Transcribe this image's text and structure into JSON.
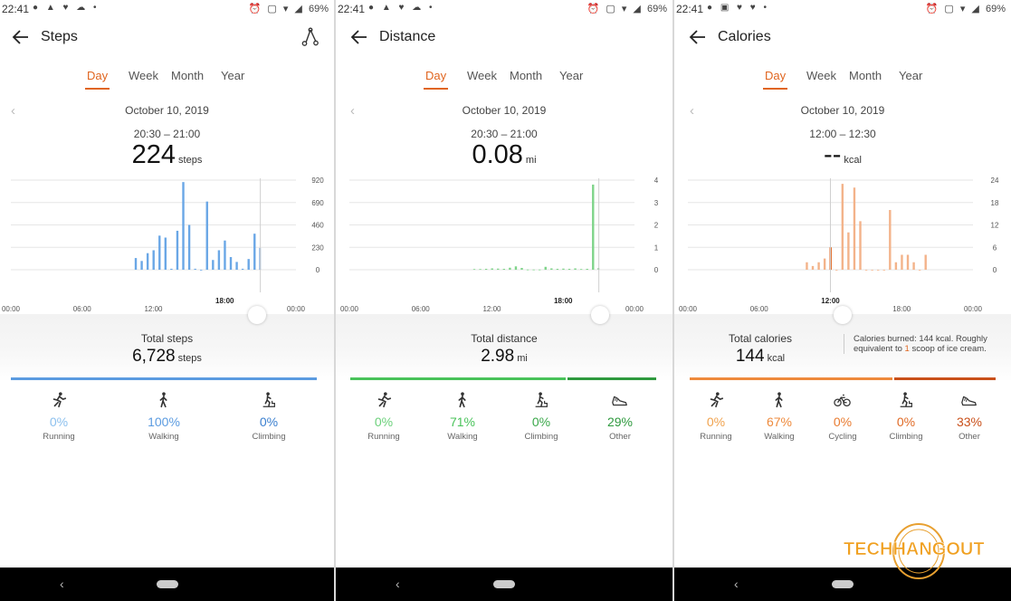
{
  "screens": [
    {
      "status": {
        "time": "22:41",
        "battery": "69%"
      },
      "title": "Steps",
      "tabs": [
        "Day",
        "Week",
        "Month",
        "Year"
      ],
      "active_tab": "Day",
      "date": "October 10, 2019",
      "range": "20:30 – 21:00",
      "value": "224",
      "value_unit": "steps",
      "total_label": "Total steps",
      "total_value": "6,728",
      "total_unit": "steps",
      "accent": "#5b9be0",
      "activities": [
        {
          "icon": "running-icon",
          "pct": "0%",
          "label": "Running",
          "color": "#8cc0ee"
        },
        {
          "icon": "walking-icon",
          "pct": "100%",
          "label": "Walking",
          "color": "#5b9be0"
        },
        {
          "icon": "climbing-icon",
          "pct": "0%",
          "label": "Climbing",
          "color": "#3a7fcf"
        }
      ]
    },
    {
      "status": {
        "time": "22:41",
        "battery": "69%"
      },
      "title": "Distance",
      "tabs": [
        "Day",
        "Week",
        "Month",
        "Year"
      ],
      "active_tab": "Day",
      "date": "October 10, 2019",
      "range": "20:30 – 21:00",
      "value": "0.08",
      "value_unit": "mi",
      "total_label": "Total distance",
      "total_value": "2.98",
      "total_unit": "mi",
      "accent": "#49c35a",
      "activities": [
        {
          "icon": "running-icon",
          "pct": "0%",
          "label": "Running",
          "color": "#6bd07a"
        },
        {
          "icon": "walking-icon",
          "pct": "71%",
          "label": "Walking",
          "color": "#49c35a"
        },
        {
          "icon": "climbing-icon",
          "pct": "0%",
          "label": "Climbing",
          "color": "#3aa84a"
        },
        {
          "icon": "shoe-icon",
          "pct": "29%",
          "label": "Other",
          "color": "#2f9a3f"
        }
      ]
    },
    {
      "status": {
        "time": "22:41",
        "battery": "69%"
      },
      "title": "Calories",
      "tabs": [
        "Day",
        "Week",
        "Month",
        "Year"
      ],
      "active_tab": "Day",
      "date": "October 10, 2019",
      "range": "12:00 – 12:30",
      "value": "--",
      "value_unit": "kcal",
      "total_label": "Total calories",
      "total_value": "144",
      "total_unit": "kcal",
      "burn_note_prefix": "Calories burned: 144 kcal. Roughly equivalent to ",
      "burn_note_highlight": "1",
      "burn_note_suffix": " scoop of ice cream.",
      "accent": "#ee8a3c",
      "activities": [
        {
          "icon": "running-icon",
          "pct": "0%",
          "label": "Running",
          "color": "#f0a24d"
        },
        {
          "icon": "walking-icon",
          "pct": "67%",
          "label": "Walking",
          "color": "#ee8a3c"
        },
        {
          "icon": "cycling-icon",
          "pct": "0%",
          "label": "Cycling",
          "color": "#e97b30"
        },
        {
          "icon": "climbing-icon",
          "pct": "0%",
          "label": "Climbing",
          "color": "#e06a25"
        },
        {
          "icon": "shoe-icon",
          "pct": "33%",
          "label": "Other",
          "color": "#c9501a"
        }
      ]
    }
  ],
  "chart_data": [
    {
      "type": "bar",
      "title": "",
      "x_ticks": [
        "00:00",
        "06:00",
        "12:00",
        "18:00",
        "00:00"
      ],
      "highlight_tick": "18:00",
      "y_ticks": [
        0,
        230,
        460,
        690,
        920
      ],
      "ylim": [
        0,
        920
      ],
      "color": "#6aa7e6",
      "highlight_color": "#1f6fd0",
      "grid": true,
      "x": [
        10.5,
        11.0,
        11.5,
        12.0,
        12.5,
        13.0,
        13.5,
        14.0,
        14.5,
        15.0,
        15.5,
        16.0,
        16.5,
        17.0,
        17.5,
        18.0,
        18.5,
        19.0,
        19.5,
        20.0,
        20.5,
        21.0
      ],
      "values": [
        120,
        90,
        170,
        200,
        350,
        330,
        10,
        400,
        900,
        460,
        10,
        0,
        700,
        100,
        200,
        300,
        130,
        80,
        10,
        110,
        370,
        224
      ],
      "highlight_x": 21.0
    },
    {
      "type": "bar",
      "title": "",
      "x_ticks": [
        "00:00",
        "06:00",
        "12:00",
        "18:00",
        "00:00"
      ],
      "highlight_tick": "18:00",
      "y_ticks": [
        0,
        1,
        2,
        3,
        4
      ],
      "ylim": [
        0,
        4
      ],
      "color": "#7fd48a",
      "highlight_color": "#2fa83f",
      "grid": true,
      "x": [
        10.5,
        11.0,
        11.5,
        12.0,
        12.5,
        13.0,
        13.5,
        14.0,
        14.5,
        15.0,
        15.5,
        16.0,
        16.5,
        17.0,
        17.5,
        18.0,
        18.5,
        19.0,
        19.5,
        20.0,
        20.5,
        21.0
      ],
      "values": [
        0.03,
        0.03,
        0.04,
        0.06,
        0.05,
        0.04,
        0.09,
        0.15,
        0.08,
        0.01,
        0.01,
        0.01,
        0.13,
        0.06,
        0.04,
        0.05,
        0.04,
        0.06,
        0.03,
        0.04,
        3.8,
        0.08
      ],
      "highlight_x": 21.0
    },
    {
      "type": "bar",
      "title": "",
      "x_ticks": [
        "00:00",
        "06:00",
        "12:00",
        "18:00",
        "00:00"
      ],
      "highlight_tick": "12:00",
      "y_ticks": [
        0,
        6,
        12,
        18,
        24
      ],
      "ylim": [
        0,
        24
      ],
      "color": "#f3b38a",
      "highlight_color": "#e0651f",
      "grid": true,
      "x": [
        10.0,
        10.5,
        11.0,
        11.5,
        12.0,
        12.5,
        13.0,
        13.5,
        14.0,
        14.5,
        15.0,
        15.5,
        16.0,
        16.5,
        17.0,
        17.5,
        18.0,
        18.5,
        19.0,
        19.5,
        20.0
      ],
      "values": [
        2,
        1,
        2,
        3,
        6,
        0,
        23,
        10,
        22,
        13,
        0,
        0,
        0,
        0,
        16,
        2,
        4,
        4,
        2,
        0,
        4
      ],
      "highlight_x": 12.0
    }
  ],
  "watermark": {
    "text_left": "TECH",
    "text_right": "HANGOUT"
  }
}
